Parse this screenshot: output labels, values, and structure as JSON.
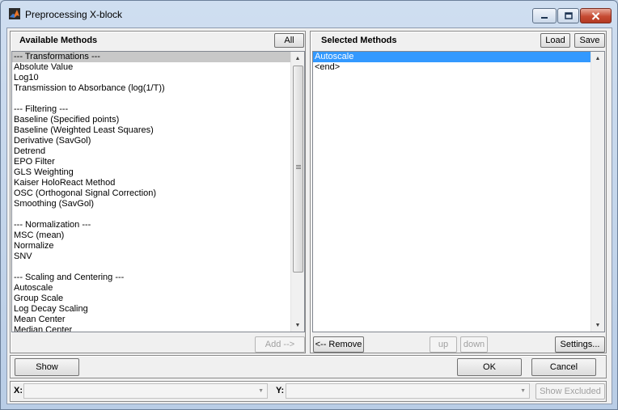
{
  "window": {
    "title": "Preprocessing X-block"
  },
  "available": {
    "title": "Available Methods",
    "all_label": "All",
    "add_label": "Add -->",
    "items": [
      "--- Transformations ---",
      "Absolute Value",
      "Log10",
      "Transmission to Absorbance (log(1/T))",
      "",
      "--- Filtering ---",
      "Baseline (Specified points)",
      "Baseline (Weighted Least Squares)",
      "Derivative (SavGol)",
      "Detrend",
      "EPO Filter",
      "GLS Weighting",
      "Kaiser HoloReact Method",
      "OSC (Orthogonal Signal Correction)",
      "Smoothing (SavGol)",
      "",
      "--- Normalization ---",
      "MSC (mean)",
      "Normalize",
      "SNV",
      "",
      "--- Scaling and Centering ---",
      "Autoscale",
      "Group Scale",
      "Log Decay Scaling",
      "Mean Center",
      "Median Center"
    ],
    "selected_index": 0
  },
  "selected": {
    "title": "Selected Methods",
    "load_label": "Load",
    "save_label": "Save",
    "items": [
      "Autoscale",
      "<end>"
    ],
    "selected_index": 0,
    "remove_label": "<-- Remove",
    "up_label": "up",
    "down_label": "down",
    "settings_label": "Settings..."
  },
  "footer": {
    "show_label": "Show",
    "ok_label": "OK",
    "cancel_label": "Cancel",
    "x_label": "X:",
    "y_label": "Y:",
    "show_excluded_label": "Show Excluded"
  }
}
